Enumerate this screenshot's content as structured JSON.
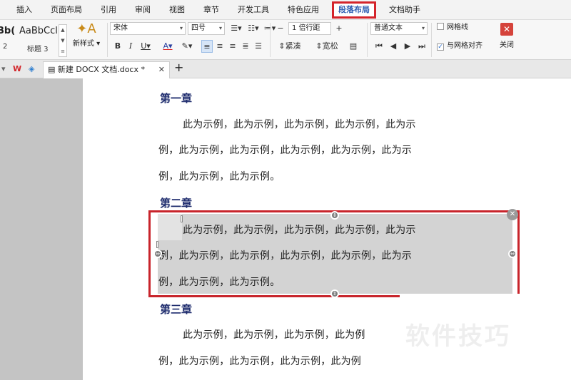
{
  "menu": {
    "tabs": [
      "插入",
      "页面布局",
      "引用",
      "审阅",
      "视图",
      "章节",
      "开发工具",
      "特色应用",
      "段落布局",
      "文档助手"
    ],
    "active": "段落布局"
  },
  "ribbon": {
    "styles": [
      {
        "sample": "Bb(",
        "name": "2"
      },
      {
        "sample": "AaBbCcl",
        "name": "标题 3"
      }
    ],
    "new_style": "新样式",
    "font_name": "宋体",
    "font_size": "四号",
    "line_spacing": "1 倍行距",
    "paragraph_style": "普通文本",
    "compact": "紧凑",
    "loose": "宽松",
    "gridlines": "网格线",
    "snap_to_grid": "与网格对齐",
    "close": "关闭"
  },
  "doc_tab": {
    "title": "新建 DOCX 文档.docx *"
  },
  "document": {
    "chapter1": {
      "heading": "第一章",
      "lines": [
        "此为示例，此为示例，此为示例，此为示例，此为示",
        "例，此为示例，此为示例，此为示例，此为示例，此为示",
        "例，此为示例，此为示例。"
      ]
    },
    "chapter2": {
      "heading": "第二章",
      "lines": [
        "此为示例，此为示例，此为示例，此为示例，此为示",
        "例，此为示例，此为示例，此为示例，此为示例，此为示",
        "例，此为示例，此为示例。"
      ]
    },
    "chapter3": {
      "heading": "第三章",
      "lines": [
        "此为示例，此为示例，此为示例，此为例",
        "例，此为示例，此为示例，此为示例，此为例"
      ]
    }
  },
  "watermark": "软件技巧",
  "colors": {
    "accent": "#2f5fb3",
    "highlight_frame": "#c8242b",
    "heading": "#1f2d6e"
  }
}
